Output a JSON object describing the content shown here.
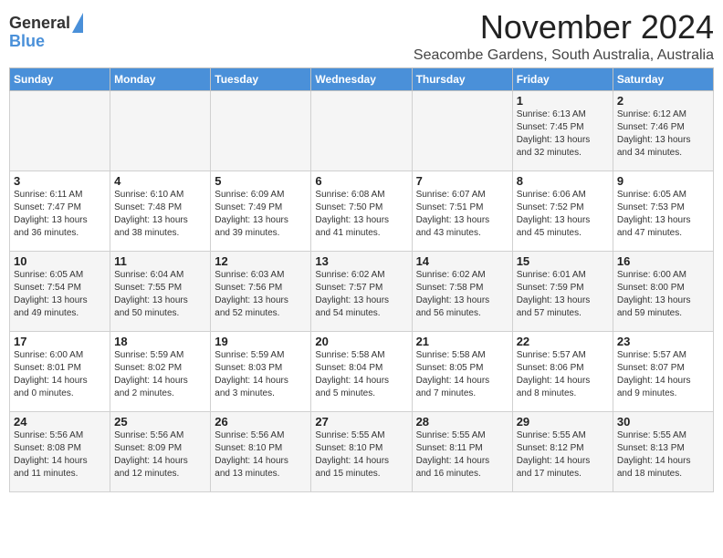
{
  "header": {
    "logo_general": "General",
    "logo_blue": "Blue",
    "month": "November 2024",
    "location": "Seacombe Gardens, South Australia, Australia"
  },
  "days_of_week": [
    "Sunday",
    "Monday",
    "Tuesday",
    "Wednesday",
    "Thursday",
    "Friday",
    "Saturday"
  ],
  "weeks": [
    [
      {
        "day": "",
        "content": ""
      },
      {
        "day": "",
        "content": ""
      },
      {
        "day": "",
        "content": ""
      },
      {
        "day": "",
        "content": ""
      },
      {
        "day": "",
        "content": ""
      },
      {
        "day": "1",
        "content": "Sunrise: 6:13 AM\nSunset: 7:45 PM\nDaylight: 13 hours\nand 32 minutes."
      },
      {
        "day": "2",
        "content": "Sunrise: 6:12 AM\nSunset: 7:46 PM\nDaylight: 13 hours\nand 34 minutes."
      }
    ],
    [
      {
        "day": "3",
        "content": "Sunrise: 6:11 AM\nSunset: 7:47 PM\nDaylight: 13 hours\nand 36 minutes."
      },
      {
        "day": "4",
        "content": "Sunrise: 6:10 AM\nSunset: 7:48 PM\nDaylight: 13 hours\nand 38 minutes."
      },
      {
        "day": "5",
        "content": "Sunrise: 6:09 AM\nSunset: 7:49 PM\nDaylight: 13 hours\nand 39 minutes."
      },
      {
        "day": "6",
        "content": "Sunrise: 6:08 AM\nSunset: 7:50 PM\nDaylight: 13 hours\nand 41 minutes."
      },
      {
        "day": "7",
        "content": "Sunrise: 6:07 AM\nSunset: 7:51 PM\nDaylight: 13 hours\nand 43 minutes."
      },
      {
        "day": "8",
        "content": "Sunrise: 6:06 AM\nSunset: 7:52 PM\nDaylight: 13 hours\nand 45 minutes."
      },
      {
        "day": "9",
        "content": "Sunrise: 6:05 AM\nSunset: 7:53 PM\nDaylight: 13 hours\nand 47 minutes."
      }
    ],
    [
      {
        "day": "10",
        "content": "Sunrise: 6:05 AM\nSunset: 7:54 PM\nDaylight: 13 hours\nand 49 minutes."
      },
      {
        "day": "11",
        "content": "Sunrise: 6:04 AM\nSunset: 7:55 PM\nDaylight: 13 hours\nand 50 minutes."
      },
      {
        "day": "12",
        "content": "Sunrise: 6:03 AM\nSunset: 7:56 PM\nDaylight: 13 hours\nand 52 minutes."
      },
      {
        "day": "13",
        "content": "Sunrise: 6:02 AM\nSunset: 7:57 PM\nDaylight: 13 hours\nand 54 minutes."
      },
      {
        "day": "14",
        "content": "Sunrise: 6:02 AM\nSunset: 7:58 PM\nDaylight: 13 hours\nand 56 minutes."
      },
      {
        "day": "15",
        "content": "Sunrise: 6:01 AM\nSunset: 7:59 PM\nDaylight: 13 hours\nand 57 minutes."
      },
      {
        "day": "16",
        "content": "Sunrise: 6:00 AM\nSunset: 8:00 PM\nDaylight: 13 hours\nand 59 minutes."
      }
    ],
    [
      {
        "day": "17",
        "content": "Sunrise: 6:00 AM\nSunset: 8:01 PM\nDaylight: 14 hours\nand 0 minutes."
      },
      {
        "day": "18",
        "content": "Sunrise: 5:59 AM\nSunset: 8:02 PM\nDaylight: 14 hours\nand 2 minutes."
      },
      {
        "day": "19",
        "content": "Sunrise: 5:59 AM\nSunset: 8:03 PM\nDaylight: 14 hours\nand 3 minutes."
      },
      {
        "day": "20",
        "content": "Sunrise: 5:58 AM\nSunset: 8:04 PM\nDaylight: 14 hours\nand 5 minutes."
      },
      {
        "day": "21",
        "content": "Sunrise: 5:58 AM\nSunset: 8:05 PM\nDaylight: 14 hours\nand 7 minutes."
      },
      {
        "day": "22",
        "content": "Sunrise: 5:57 AM\nSunset: 8:06 PM\nDaylight: 14 hours\nand 8 minutes."
      },
      {
        "day": "23",
        "content": "Sunrise: 5:57 AM\nSunset: 8:07 PM\nDaylight: 14 hours\nand 9 minutes."
      }
    ],
    [
      {
        "day": "24",
        "content": "Sunrise: 5:56 AM\nSunset: 8:08 PM\nDaylight: 14 hours\nand 11 minutes."
      },
      {
        "day": "25",
        "content": "Sunrise: 5:56 AM\nSunset: 8:09 PM\nDaylight: 14 hours\nand 12 minutes."
      },
      {
        "day": "26",
        "content": "Sunrise: 5:56 AM\nSunset: 8:10 PM\nDaylight: 14 hours\nand 13 minutes."
      },
      {
        "day": "27",
        "content": "Sunrise: 5:55 AM\nSunset: 8:10 PM\nDaylight: 14 hours\nand 15 minutes."
      },
      {
        "day": "28",
        "content": "Sunrise: 5:55 AM\nSunset: 8:11 PM\nDaylight: 14 hours\nand 16 minutes."
      },
      {
        "day": "29",
        "content": "Sunrise: 5:55 AM\nSunset: 8:12 PM\nDaylight: 14 hours\nand 17 minutes."
      },
      {
        "day": "30",
        "content": "Sunrise: 5:55 AM\nSunset: 8:13 PM\nDaylight: 14 hours\nand 18 minutes."
      }
    ]
  ]
}
